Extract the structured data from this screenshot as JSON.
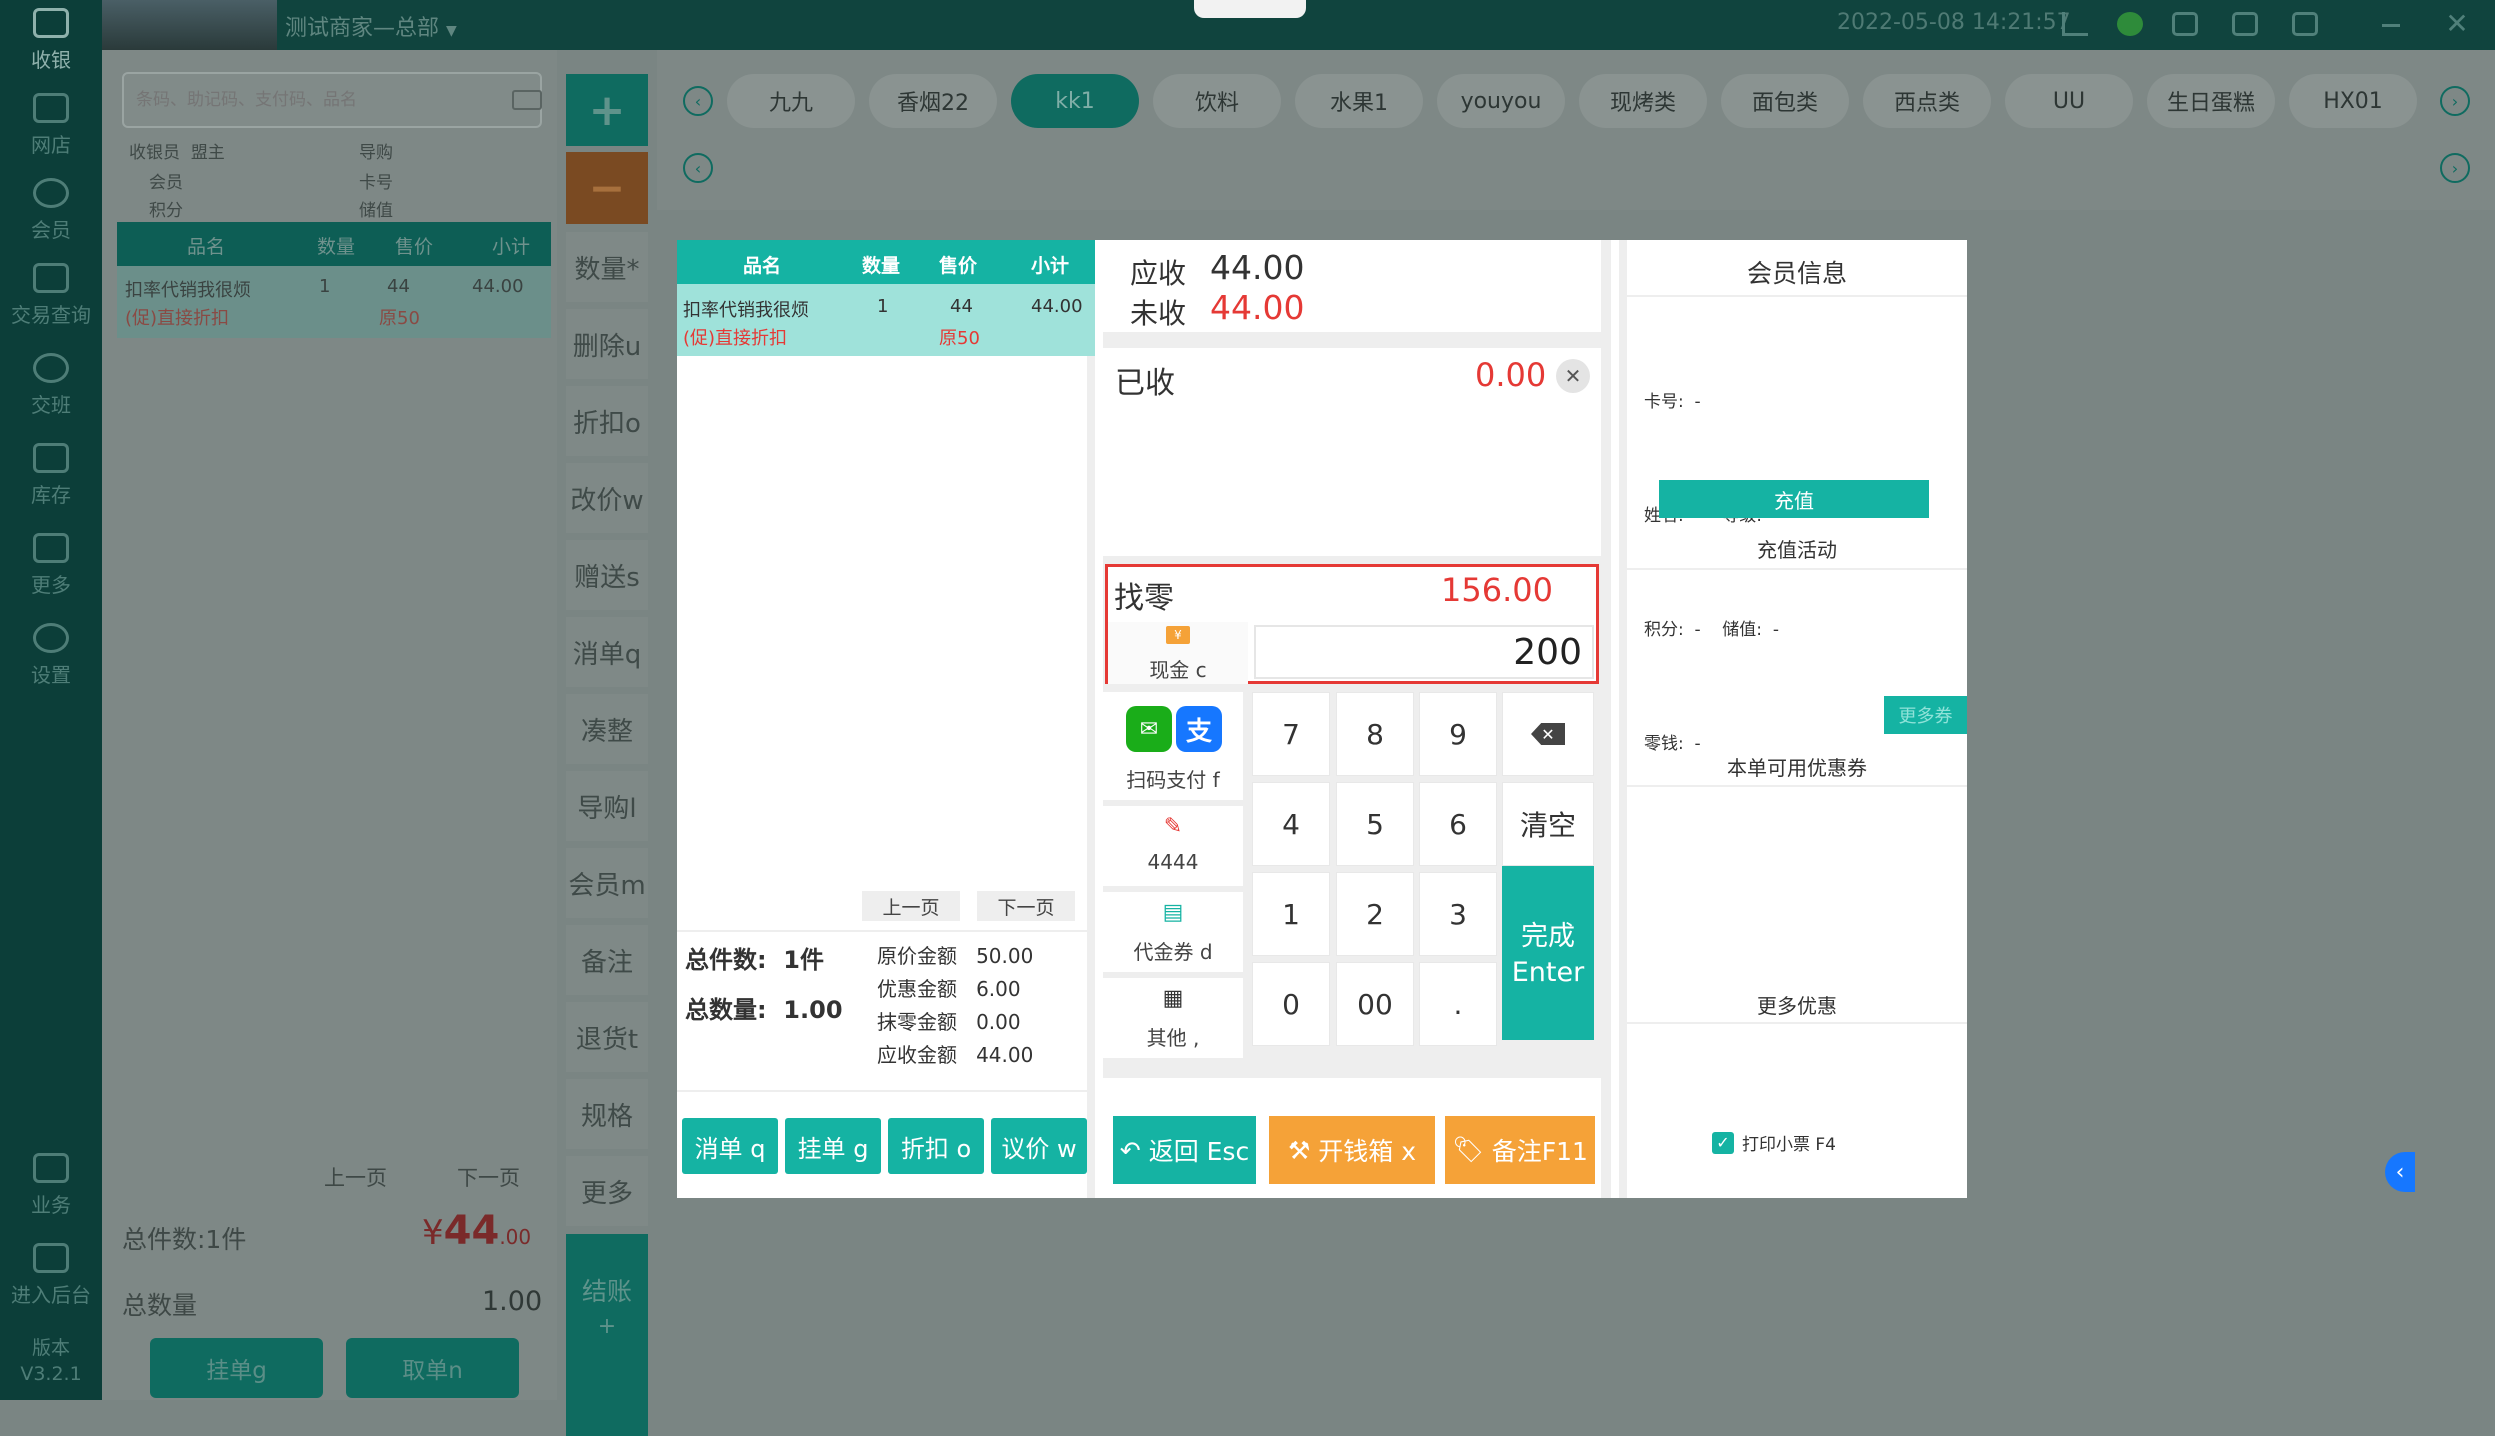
{
  "app": {
    "store_name": "测试商家—总部",
    "datetime": "2022-05-08 14:21:57",
    "version_label": "版本",
    "version": "V3.2.1"
  },
  "nav": [
    "收银",
    "网店",
    "会员",
    "交易查询",
    "交班",
    "库存",
    "更多",
    "设置",
    "业务",
    "进入后台"
  ],
  "search": {
    "placeholder": "条码、助记码、支付码、品名"
  },
  "info": {
    "cashier_label": "收银员",
    "cashier": "盟主",
    "guide_label": "导购",
    "member_label": "会员",
    "card_label": "卡号",
    "points_label": "积分",
    "balance_label": "储值"
  },
  "table_headers": [
    "品名",
    "数量",
    "售价",
    "小计"
  ],
  "items": [
    {
      "name": "扣率代销我很烦",
      "qty": "1",
      "price": "44",
      "subtotal": "44.00",
      "promo": "(促)直接折扣",
      "original": "原50"
    }
  ],
  "categories": [
    "九九",
    "香烟22",
    "kk1",
    "饮料",
    "水果1",
    "youyou",
    "现烤类",
    "面包类",
    "西点类",
    "UU",
    "生日蛋糕",
    "HX01"
  ],
  "side_actions": [
    "数量*",
    "删除u",
    "折扣o",
    "改价w",
    "赠送s",
    "消单q",
    "凑整",
    "导购l",
    "会员m",
    "备注",
    "退货t",
    "规格",
    "更多"
  ],
  "checkout_label": "结账",
  "checkout_sub": "+",
  "left_panel": {
    "prev_page": "上一页",
    "next_page": "下一页",
    "total_items_label": "总件数:1件",
    "currency_symbol": "¥",
    "amount_int": "44",
    "amount_dec": ".00",
    "total_qty_label": "总数量",
    "total_qty": "1.00",
    "hold_button": "挂单g",
    "retrieve_button": "取单n"
  },
  "modal": {
    "prev_page": "上一页",
    "next_page": "下一页",
    "total_items": "总件数:  1件",
    "total_qty": "总数量:  1.00",
    "summary": [
      {
        "label": "原价金额",
        "value": "50.00"
      },
      {
        "label": "优惠金额",
        "value": "6.00"
      },
      {
        "label": "抹零金额",
        "value": "0.00"
      },
      {
        "label": "应收金额",
        "value": "44.00"
      }
    ],
    "bottom_buttons": [
      "消单 q",
      "挂单 g",
      "折扣 o",
      "议价 w"
    ],
    "receivable_label": "应收",
    "receivable": "44.00",
    "unpaid_label": "未收",
    "unpaid": "44.00",
    "paid_label": "已收",
    "paid": "0.00",
    "change_label": "找零",
    "change": "156.00",
    "input_value": "200",
    "pay_methods": [
      {
        "label": "现金 c",
        "icon": "cash-icon"
      },
      {
        "label": "扫码支付 f",
        "icon": "qr-pay-icon"
      },
      {
        "label": "4444",
        "icon": "pencil-icon"
      },
      {
        "label": "代金券 d",
        "icon": "voucher-icon"
      },
      {
        "label": "其他 ,",
        "icon": "grid-icon"
      }
    ],
    "keys": [
      "7",
      "8",
      "9",
      "4",
      "5",
      "6",
      "1",
      "2",
      "3",
      "0",
      "00",
      "."
    ],
    "clear_key": "清空",
    "complete_line1": "完成",
    "complete_line2": "Enter",
    "back_button": "返回 Esc",
    "drawer_button": "开钱箱 x",
    "note_button": "备注F11",
    "member_title": "会员信息",
    "member_fields": {
      "card": "卡号:  -",
      "name_level": "姓名:  -    等级:  -",
      "points_balance": "积分:  -    储值:  -",
      "change": "零钱:  -"
    },
    "recharge_button": "充值",
    "recharge_activity": "充值活动",
    "more_coupons": "更多券",
    "available_coupons": "本单可用优惠券",
    "more_discounts": "更多优惠",
    "print_receipt": "打印小票 F4"
  },
  "colors": {
    "accent": "#15b3a3",
    "red": "#e53935",
    "orange": "#f5a238"
  }
}
